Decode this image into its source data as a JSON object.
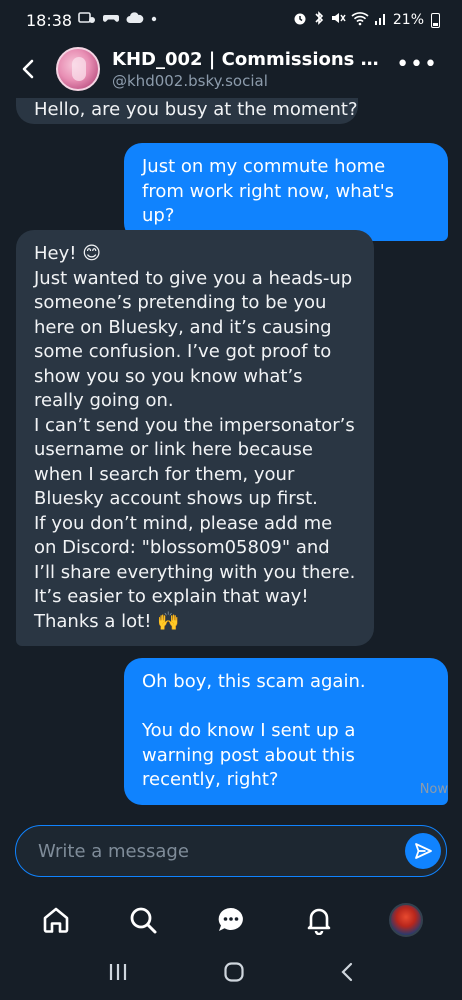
{
  "status_bar": {
    "time": "18:38",
    "left_icons": [
      "notification-icon",
      "game-icon",
      "cloud-icon",
      "dot-icon"
    ],
    "right_icons": [
      "alarm-icon",
      "bluetooth-icon",
      "mute-icon",
      "wifi-icon",
      "signal-icon"
    ],
    "battery": "21%"
  },
  "header": {
    "title": "KHD_002 | Commissions op...",
    "handle": "@khd002.bsky.social",
    "more_label": "•••"
  },
  "messages": [
    {
      "sender": "them",
      "text": "Hello, are you busy at the moment?"
    },
    {
      "sender": "me",
      "text": "Just on my commute home from work right now, what's up?"
    },
    {
      "sender": "them",
      "text": "Hey! 😊\nJust wanted to give you a heads-up someone’s pretending to be you here on Bluesky, and it’s causing some confusion. I’ve got proof to show you so you know what’s really going on.\nI can’t send you the impersonator’s username or link here because when I search for them, your Bluesky account shows up first.\nIf you don’t mind, please add me on Discord: \"blossom05809\" and I’ll share everything with you there. It’s easier to explain that way!\nThanks a lot! 🙌"
    },
    {
      "sender": "me",
      "text": "Oh boy, this scam again.\n\nYou do know I sent up a warning post about this recently, right?"
    }
  ],
  "timestamp": "Now",
  "composer": {
    "placeholder": "Write a message"
  },
  "bottom_nav": [
    "home-icon",
    "search-icon",
    "chat-icon",
    "bell-icon",
    "profile-avatar"
  ],
  "system_nav": [
    "recents-icon",
    "home-circle-icon",
    "back-icon"
  ],
  "colors": {
    "background": "#161e27",
    "incoming": "#2a3643",
    "outgoing": "#1083fe",
    "accent": "#1083fe",
    "muted": "#8c9bab"
  }
}
